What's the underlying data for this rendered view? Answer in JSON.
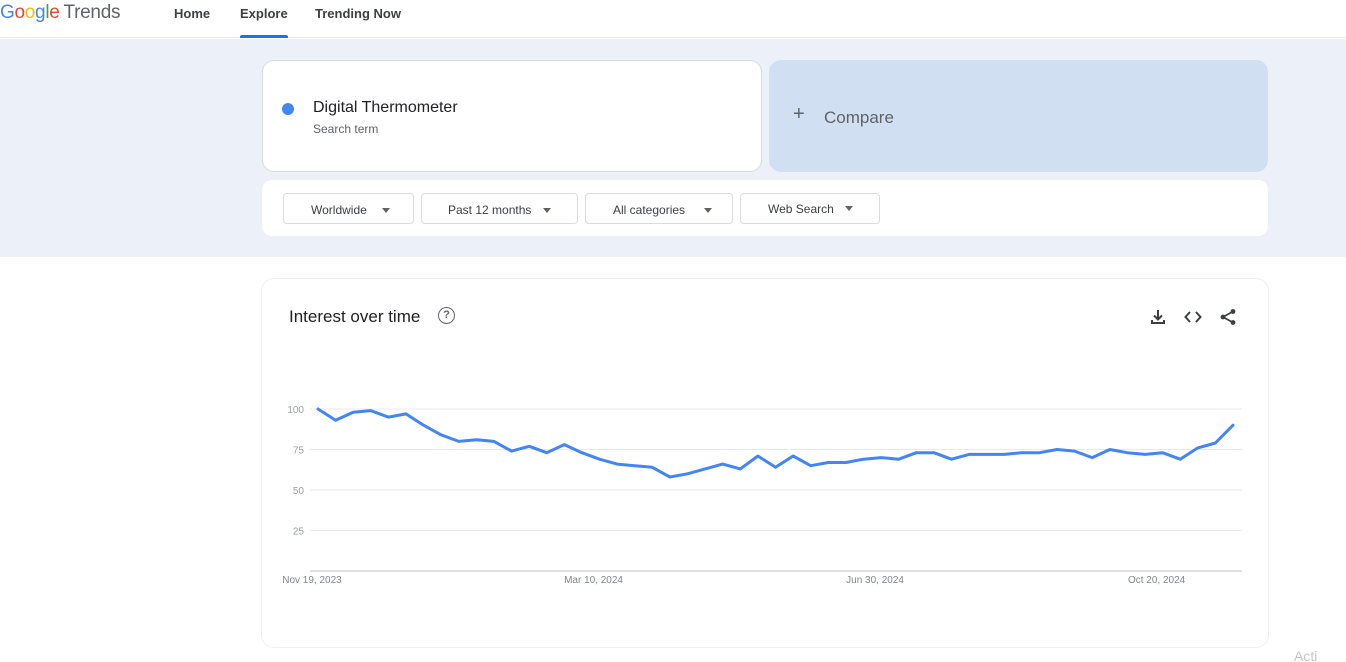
{
  "app": {
    "logo_google": [
      "G",
      "o",
      "o",
      "g",
      "l",
      "e"
    ],
    "logo_trends": "Trends"
  },
  "nav": {
    "home": "Home",
    "explore": "Explore",
    "trending_now": "Trending Now",
    "active": "Explore"
  },
  "search": {
    "term": "Digital Thermometer",
    "term_subtitle": "Search term",
    "term_color": "#4285f4",
    "compare_label": "Compare"
  },
  "filters": {
    "region": "Worldwide",
    "time_range": "Past 12 months",
    "category": "All categories",
    "search_type": "Web Search"
  },
  "interest_over_time": {
    "title": "Interest over time",
    "help_icon": "help-circle-icon",
    "tools": [
      "download-icon",
      "embed-code-icon",
      "share-icon"
    ]
  },
  "chart_data": {
    "type": "line",
    "title": "",
    "xlabel": "",
    "ylabel": "",
    "ylim": [
      0,
      100
    ],
    "yticks": [
      25,
      50,
      75,
      100
    ],
    "xtick_labels": [
      {
        "label": "Nov 19, 2023",
        "index": 0
      },
      {
        "label": "Mar 10, 2024",
        "index": 16
      },
      {
        "label": "Jun 30, 2024",
        "index": 32
      },
      {
        "label": "Oct 20, 2024",
        "index": 48
      }
    ],
    "grid": true,
    "series": [
      {
        "name": "Digital Thermometer",
        "color": "#4285f4",
        "values": [
          100,
          93,
          98,
          99,
          95,
          97,
          90,
          84,
          80,
          81,
          80,
          74,
          77,
          73,
          78,
          73,
          69,
          66,
          65,
          64,
          58,
          60,
          63,
          66,
          63,
          71,
          64,
          71,
          65,
          67,
          67,
          69,
          70,
          69,
          73,
          73,
          69,
          72,
          72,
          72,
          73,
          73,
          75,
          74,
          70,
          75,
          73,
          72,
          73,
          69,
          76,
          79,
          90
        ]
      }
    ]
  },
  "footer": {
    "corner_text": "Acti"
  }
}
